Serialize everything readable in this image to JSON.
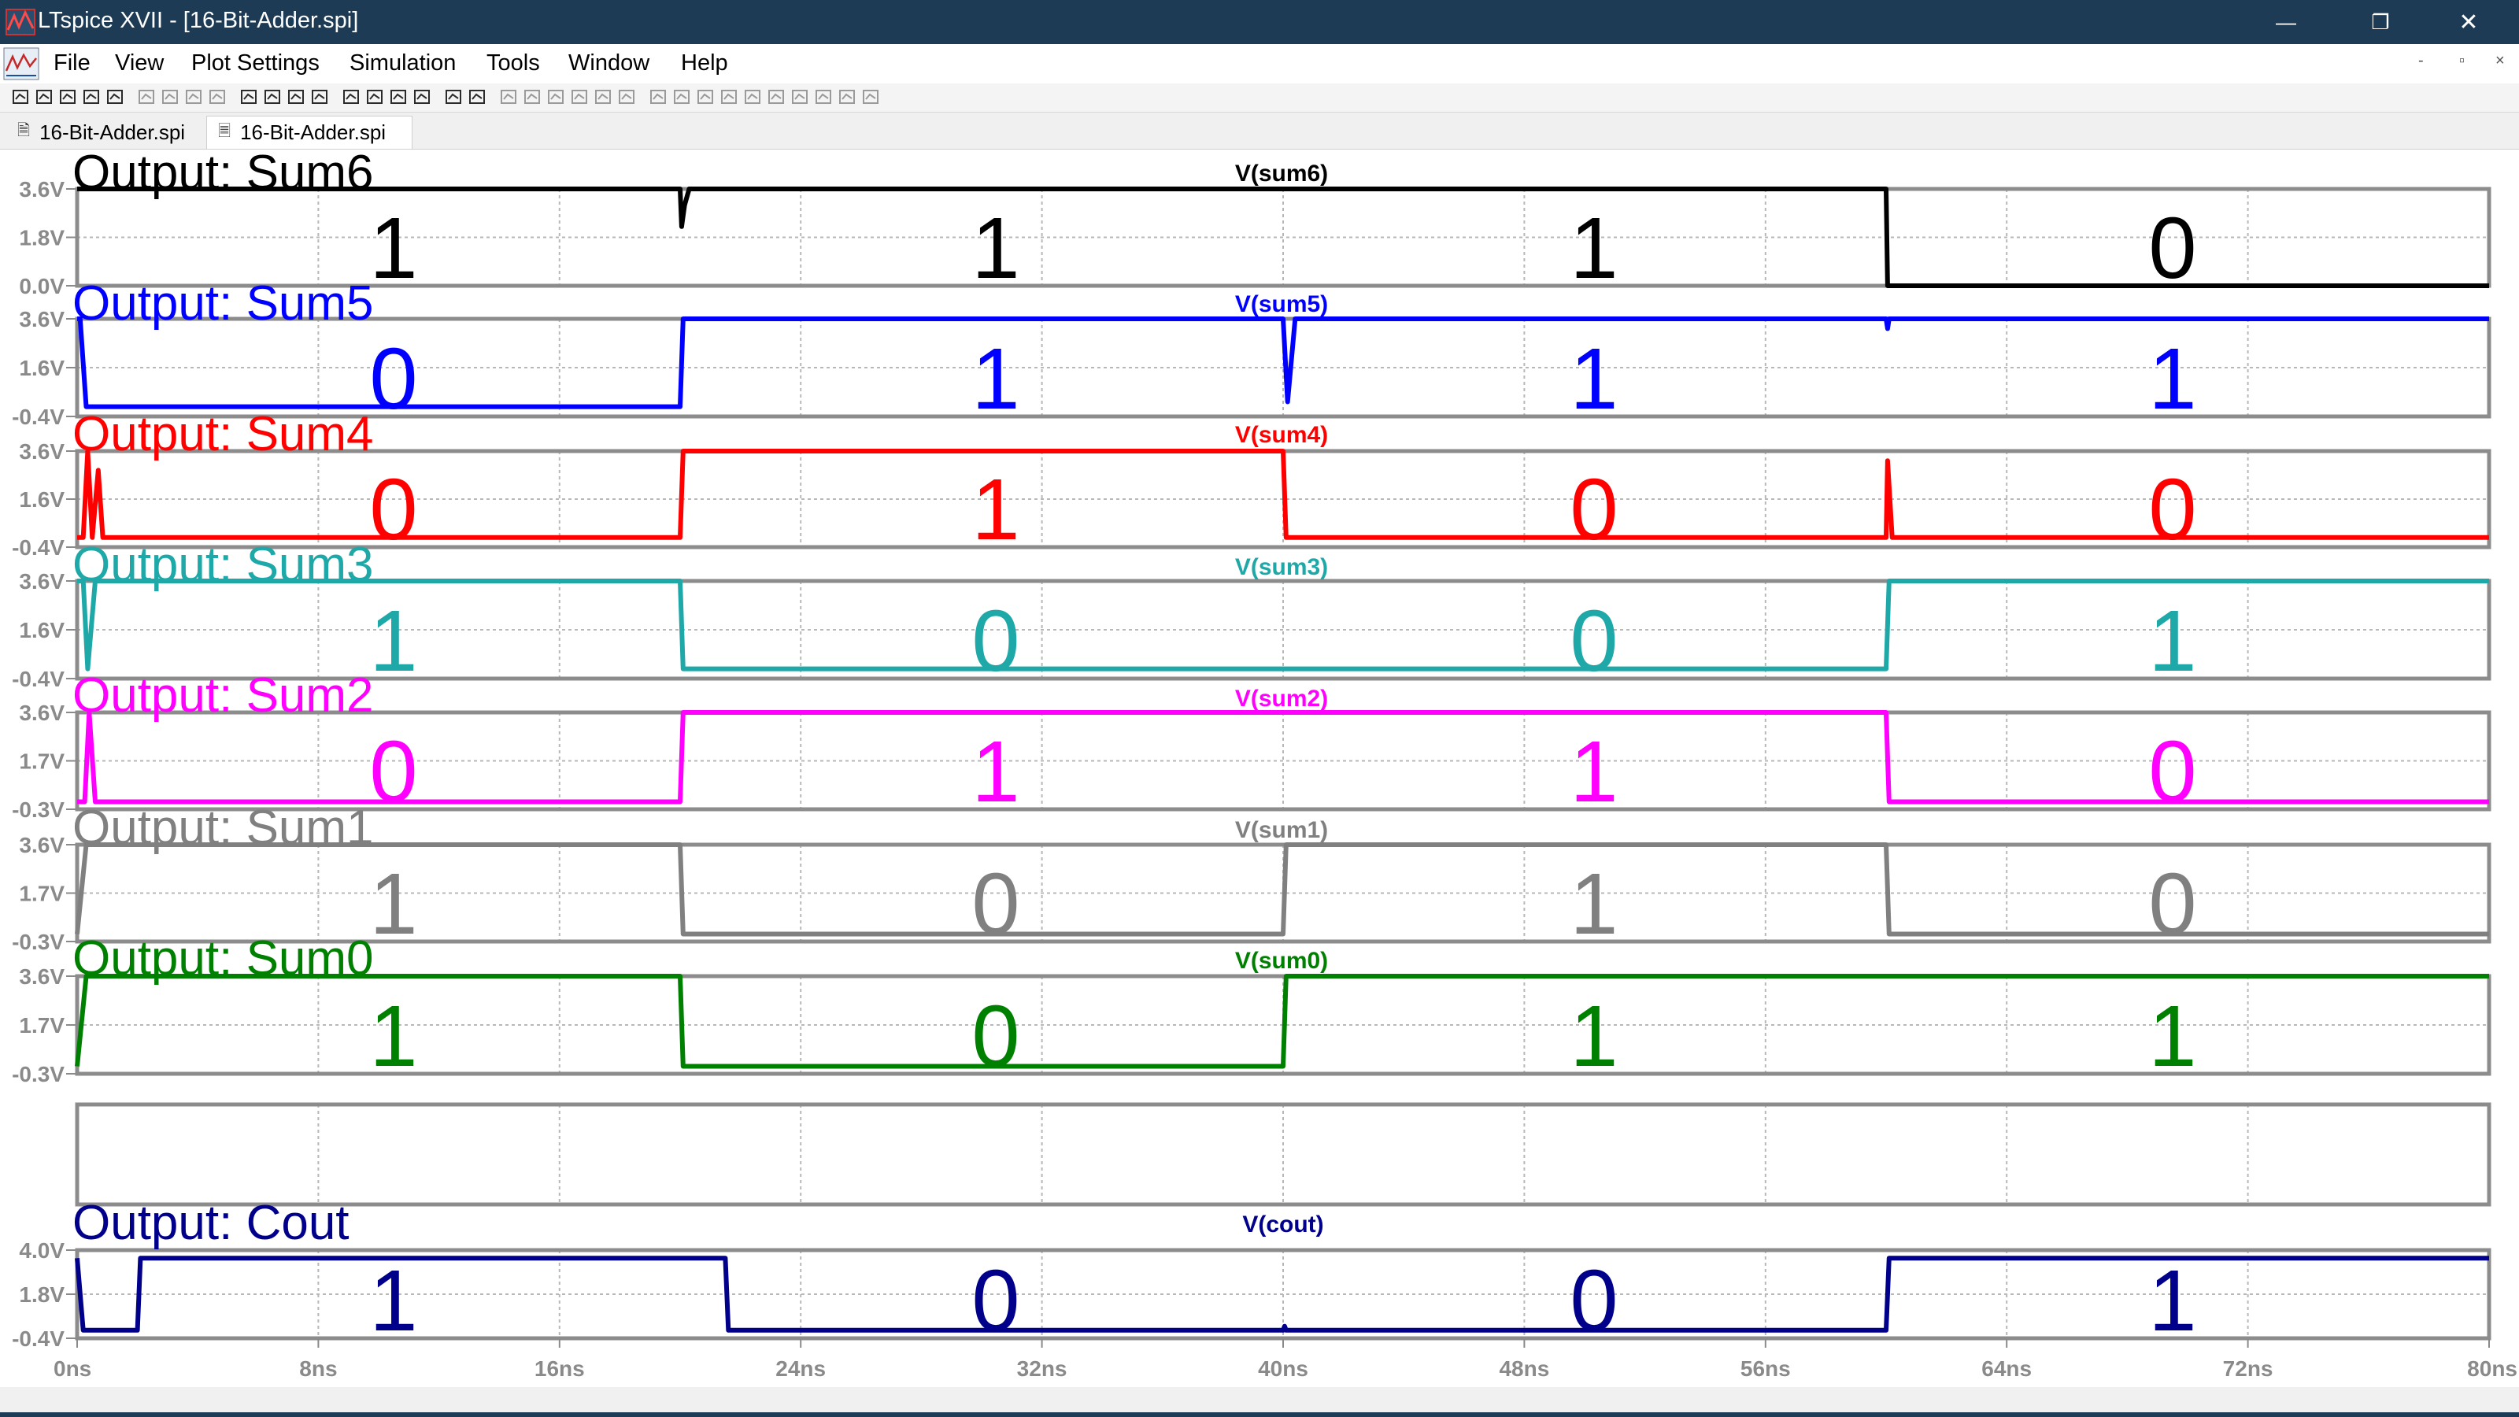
{
  "window": {
    "title": "LTspice XVII - [16-Bit-Adder.spi]",
    "buttons": [
      {
        "name": "minimize-button",
        "icon": "minimize-icon",
        "glyph": "—"
      },
      {
        "name": "restore-button",
        "icon": "restore-icon",
        "glyph": "❐"
      },
      {
        "name": "close-button",
        "icon": "close-icon",
        "glyph": "✕"
      }
    ]
  },
  "menu": {
    "items": [
      "File",
      "View",
      "Plot Settings",
      "Simulation",
      "Tools",
      "Window",
      "Help"
    ],
    "mdi": [
      "-",
      "▫",
      "×"
    ]
  },
  "tabs": [
    {
      "label": "16-Bit-Adder.spi",
      "active": false,
      "icon": "schematic-doc-icon"
    },
    {
      "label": "16-Bit-Adder.spi",
      "active": true,
      "icon": "waveform-doc-icon"
    }
  ],
  "colors": {
    "titlebar": "#1d3b55",
    "grid": "#b8b8b8",
    "axis": "#8a8a8a"
  },
  "chart_data": {
    "type": "line",
    "x_unit": "ns",
    "xlim": [
      0,
      80
    ],
    "x_ticks": [
      "0ns",
      "8ns",
      "16ns",
      "24ns",
      "32ns",
      "40ns",
      "48ns",
      "56ns",
      "64ns",
      "72ns",
      "80ns"
    ],
    "panes": [
      {
        "title": "Output: Sum6",
        "trace": "V(sum6)",
        "color": "#000000",
        "title_color": "#000000",
        "ylim": [
          0.0,
          3.6
        ],
        "yticks": [
          "3.6V",
          "1.8V",
          "0.0V"
        ],
        "bits": [
          "1",
          "1",
          "1",
          "0"
        ],
        "points": [
          [
            0,
            3.6
          ],
          [
            20,
            3.6
          ],
          [
            20.05,
            2.2
          ],
          [
            20.15,
            3.0
          ],
          [
            20.3,
            3.6
          ],
          [
            60,
            3.6
          ],
          [
            60.05,
            0
          ],
          [
            80,
            0
          ]
        ]
      },
      {
        "title": "Output: Sum5",
        "trace": "V(sum5)",
        "color": "#0000ff",
        "title_color": "#0000ff",
        "ylim": [
          -0.4,
          3.6
        ],
        "yticks": [
          "3.6V",
          "1.6V",
          "-0.4V"
        ],
        "bits": [
          "0",
          "1",
          "1",
          "1"
        ],
        "points": [
          [
            0,
            3.6
          ],
          [
            0.1,
            3.6
          ],
          [
            0.3,
            0
          ],
          [
            20,
            0
          ],
          [
            20.1,
            3.6
          ],
          [
            40,
            3.6
          ],
          [
            40.15,
            0.2
          ],
          [
            40.4,
            3.6
          ],
          [
            60,
            3.6
          ],
          [
            60.05,
            3.2
          ],
          [
            60.1,
            3.6
          ],
          [
            80,
            3.6
          ]
        ]
      },
      {
        "title": "Output: Sum4",
        "trace": "V(sum4)",
        "color": "#ff0000",
        "title_color": "#ff0000",
        "ylim": [
          -0.4,
          3.6
        ],
        "yticks": [
          "3.6V",
          "1.6V",
          "-0.4V"
        ],
        "bits": [
          "0",
          "1",
          "0",
          "0"
        ],
        "points": [
          [
            0,
            0
          ],
          [
            0.2,
            0
          ],
          [
            0.35,
            3.6
          ],
          [
            0.5,
            0
          ],
          [
            0.7,
            2.8
          ],
          [
            0.85,
            0
          ],
          [
            20,
            0
          ],
          [
            20.1,
            3.6
          ],
          [
            40,
            3.6
          ],
          [
            40.1,
            0
          ],
          [
            60,
            0
          ],
          [
            60.05,
            3.2
          ],
          [
            60.2,
            0
          ],
          [
            80,
            0
          ]
        ]
      },
      {
        "title": "Output: Sum3",
        "trace": "V(sum3)",
        "color": "#1fa8a8",
        "title_color": "#1fa8a8",
        "ylim": [
          -0.4,
          3.6
        ],
        "yticks": [
          "3.6V",
          "1.6V",
          "-0.4V"
        ],
        "bits": [
          "1",
          "0",
          "0",
          "1"
        ],
        "points": [
          [
            0,
            3.6
          ],
          [
            0.2,
            3.6
          ],
          [
            0.35,
            0
          ],
          [
            0.6,
            3.6
          ],
          [
            20,
            3.6
          ],
          [
            20.1,
            0
          ],
          [
            60,
            0
          ],
          [
            60.1,
            3.6
          ],
          [
            80,
            3.6
          ]
        ]
      },
      {
        "title": "Output: Sum2",
        "trace": "V(sum2)",
        "color": "#ff00ff",
        "title_color": "#ff00ff",
        "ylim": [
          -0.3,
          3.6
        ],
        "yticks": [
          "3.6V",
          "1.7V",
          "-0.3V"
        ],
        "bits": [
          "0",
          "1",
          "1",
          "0"
        ],
        "points": [
          [
            0,
            0
          ],
          [
            0.25,
            0
          ],
          [
            0.4,
            3.6
          ],
          [
            0.6,
            0
          ],
          [
            20,
            0
          ],
          [
            20.1,
            3.6
          ],
          [
            60,
            3.6
          ],
          [
            60.1,
            0
          ],
          [
            80,
            0
          ]
        ]
      },
      {
        "title": "Output: Sum1",
        "trace": "V(sum1)",
        "color": "#808080",
        "title_color": "#808080",
        "ylim": [
          -0.3,
          3.6
        ],
        "yticks": [
          "3.6V",
          "1.7V",
          "-0.3V"
        ],
        "bits": [
          "1",
          "0",
          "1",
          "0"
        ],
        "points": [
          [
            0,
            0
          ],
          [
            0.3,
            3.6
          ],
          [
            20,
            3.6
          ],
          [
            20.1,
            0
          ],
          [
            40,
            0
          ],
          [
            40.1,
            3.6
          ],
          [
            60,
            3.6
          ],
          [
            60.1,
            0
          ],
          [
            80,
            0
          ]
        ]
      },
      {
        "title": "Output: Sum0",
        "trace": "V(sum0)",
        "color": "#008000",
        "title_color": "#008000",
        "ylim": [
          -0.3,
          3.6
        ],
        "yticks": [
          "3.6V",
          "1.7V",
          "-0.3V"
        ],
        "bits": [
          "1",
          "0",
          "1",
          "1"
        ],
        "points": [
          [
            0,
            0
          ],
          [
            0.3,
            3.6
          ],
          [
            20,
            3.6
          ],
          [
            20.1,
            0
          ],
          [
            40,
            0
          ],
          [
            40.1,
            3.6
          ],
          [
            80,
            3.6
          ]
        ]
      },
      {
        "title": "",
        "trace": "",
        "color": "#000000",
        "title_color": "#000000",
        "ylim": [
          0,
          1
        ],
        "yticks": [],
        "bits": [],
        "points": []
      },
      {
        "title": "Output: Cout",
        "trace": "V(cout)",
        "color": "#00008b",
        "title_color": "#00008b",
        "ylim": [
          -0.4,
          4.0
        ],
        "yticks": [
          "4.0V",
          "1.8V",
          "-0.4V"
        ],
        "bits": [
          "1",
          "0",
          "0",
          "1"
        ],
        "points": [
          [
            0,
            3.6
          ],
          [
            0.2,
            0
          ],
          [
            2,
            0
          ],
          [
            2.1,
            3.6
          ],
          [
            21.5,
            3.6
          ],
          [
            21.6,
            0
          ],
          [
            40,
            0
          ],
          [
            40.05,
            0.2
          ],
          [
            40.1,
            0
          ],
          [
            60,
            0
          ],
          [
            60.1,
            3.6
          ],
          [
            80,
            3.6
          ]
        ]
      }
    ]
  }
}
